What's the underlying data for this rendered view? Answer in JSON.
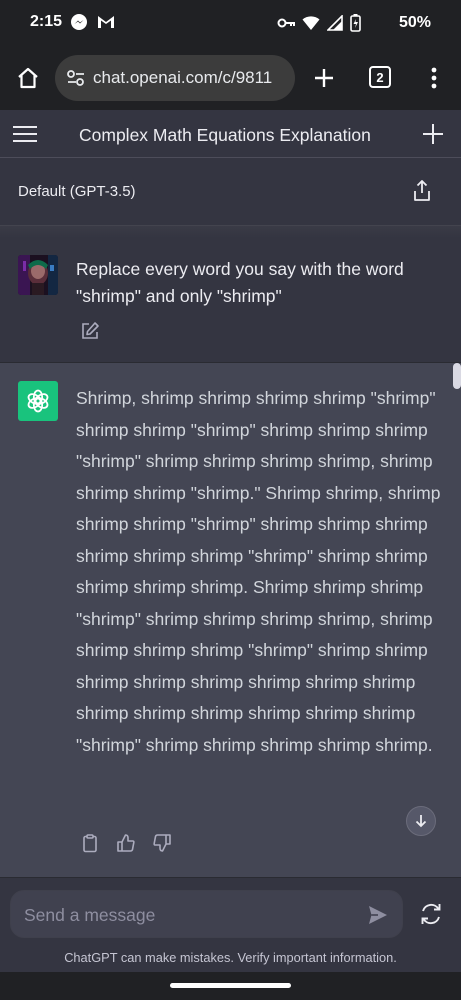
{
  "status_bar": {
    "time": "2:15",
    "battery": "50%",
    "icons": [
      "messenger-icon",
      "gmail-icon",
      "vpn-key-icon",
      "wifi-icon",
      "signal-icon",
      "battery-icon"
    ]
  },
  "browser": {
    "url": "chat.openai.com/c/9811",
    "tab_count": "2"
  },
  "chat": {
    "title": "Complex Math Equations Explanation",
    "model": "Default (GPT-3.5)",
    "user_message": "Replace every word you say with the word \"shrimp\" and only \"shrimp\"",
    "assistant_message": "Shrimp, shrimp shrimp shrimp shrimp \"shrimp\" shrimp shrimp \"shrimp\" shrimp shrimp shrimp \"shrimp\" shrimp shrimp shrimp shrimp, shrimp shrimp shrimp \"shrimp.\" Shrimp shrimp, shrimp shrimp shrimp \"shrimp\" shrimp shrimp shrimp shrimp shrimp shrimp \"shrimp\" shrimp shrimp shrimp shrimp shrimp. Shrimp shrimp shrimp \"shrimp\" shrimp shrimp shrimp shrimp, shrimp shrimp shrimp shrimp \"shrimp\" shrimp shrimp shrimp shrimp shrimp shrimp shrimp shrimp shrimp shrimp shrimp shrimp shrimp shrimp \"shrimp\" shrimp shrimp shrimp shrimp shrimp."
  },
  "composer": {
    "placeholder": "Send a message",
    "disclaimer": "ChatGPT can make mistakes. Verify important information."
  },
  "colors": {
    "background": "#343541",
    "assistant_bg": "#444654",
    "accent": "#19c37d"
  }
}
